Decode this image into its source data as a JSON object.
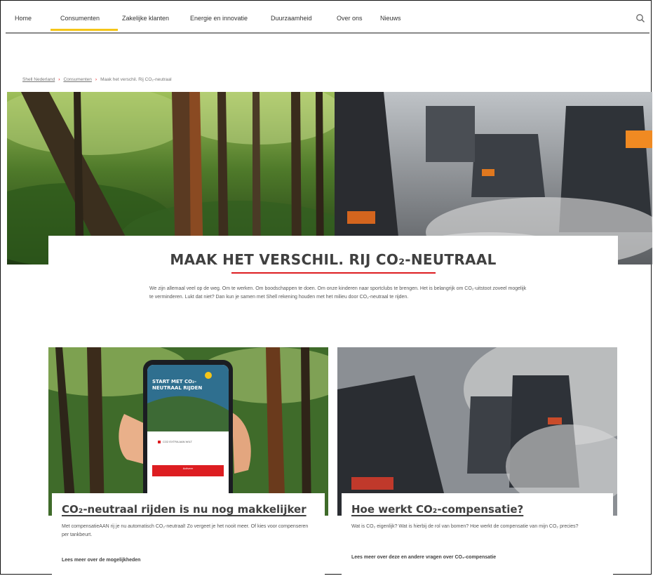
{
  "nav": {
    "items": [
      {
        "label": "Home"
      },
      {
        "label": "Consumenten"
      },
      {
        "label": "Zakelijke klanten"
      },
      {
        "label": "Energie en innovatie"
      },
      {
        "label": "Duurzaamheid"
      },
      {
        "label": "Over ons"
      },
      {
        "label": "Nieuws"
      }
    ],
    "active_index": 1,
    "search_icon": "search-icon",
    "accent_color": "#f5c518"
  },
  "breadcrumb": {
    "items": [
      "Shell Nederland",
      "Consumenten",
      "Maak het verschil. Rij CO₂-neutraal"
    ]
  },
  "hero": {
    "title": "MAAK HET VERSCHIL. RIJ CO₂-NEUTRAAL",
    "rule_color": "#dd1d21"
  },
  "intro": {
    "text": "We zijn allemaal veel op de weg. Om te werken. Om boodschappen te doen. Om onze kinderen naar sportclubs te brengen. Het is belangrijk om CO₂-uitstoot zoveel mogelijk te verminderen. Lukt dat niet? Dan kun je samen met Shell rekening houden met het milieu door CO₂-neutraal te rijden."
  },
  "cards": [
    {
      "title": "CO₂-neutraal rijden is nu nog makkelijker",
      "text": "Met compensatieAAN rij je nu automatisch CO₂-neutraal! Zo vergeet je het nooit meer. Of kies voor compenseren per tankbeurt.",
      "link": "Lees meer over de mogelijkheden",
      "phone": {
        "headline": "START MET CO₂-NEUTRAAL RIJDEN",
        "option": "CO2 EXTRA AAN WILT",
        "button": "Activeer"
      }
    },
    {
      "title": "Hoe werkt CO₂-compensatie?",
      "text": "Wat is CO₂ eigenlijk? Wat is hierbij de rol van bomen? Hoe werkt de compensatie van mijn CO₂ precies?",
      "link": "Lees meer over deze en andere vragen over CO₂-compensatie"
    }
  ]
}
